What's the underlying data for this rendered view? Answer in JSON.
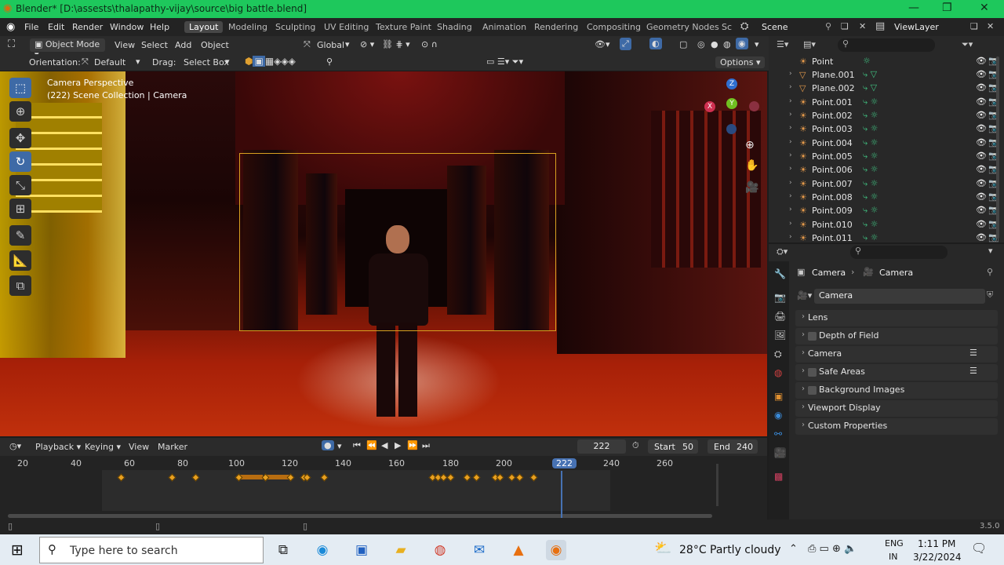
{
  "window": {
    "title": "Blender* [D:\\assests\\thalapathy-vijay\\source\\big battle.blend]"
  },
  "menu": {
    "items": [
      "File",
      "Edit",
      "Render",
      "Window",
      "Help"
    ]
  },
  "workspaces": [
    "Layout",
    "Modeling",
    "Sculpting",
    "UV Editing",
    "Texture Paint",
    "Shading",
    "Animation",
    "Rendering",
    "Compositing",
    "Geometry Nodes",
    "Sc"
  ],
  "scene": {
    "label": "Scene",
    "viewlayer": "ViewLayer"
  },
  "viewport_header": {
    "mode": "Object Mode",
    "menus": [
      "View",
      "Select",
      "Add",
      "Object"
    ],
    "transform": "Global"
  },
  "tool_header": {
    "orientation_label": "Orientation:",
    "orientation_value": "Default",
    "drag_label": "Drag:",
    "drag_value": "Select Box",
    "options": "Options"
  },
  "viewport": {
    "line1": "Camera Perspective",
    "line2": "(222) Scene Collection | Camera",
    "gizmo": {
      "x": "X",
      "y": "Y",
      "z": "Z"
    }
  },
  "timeline": {
    "menus": [
      "Playback",
      "Keying",
      "View",
      "Marker"
    ],
    "current_frame": "222",
    "start_label": "Start",
    "start": "50",
    "end_label": "End",
    "end": "240",
    "ticks": [
      "20",
      "40",
      "60",
      "80",
      "100",
      "120",
      "140",
      "160",
      "180",
      "200",
      "222",
      "240",
      "260"
    ]
  },
  "outliner": {
    "rows": [
      {
        "name": "Point",
        "icon": "light-icon"
      },
      {
        "name": "Plane.001",
        "icon": "mesh-icon"
      },
      {
        "name": "Plane.002",
        "icon": "mesh-icon"
      },
      {
        "name": "Point.001",
        "icon": "light-icon"
      },
      {
        "name": "Point.002",
        "icon": "light-icon"
      },
      {
        "name": "Point.003",
        "icon": "light-icon"
      },
      {
        "name": "Point.004",
        "icon": "light-icon"
      },
      {
        "name": "Point.005",
        "icon": "light-icon"
      },
      {
        "name": "Point.006",
        "icon": "light-icon"
      },
      {
        "name": "Point.007",
        "icon": "light-icon"
      },
      {
        "name": "Point.008",
        "icon": "light-icon"
      },
      {
        "name": "Point.009",
        "icon": "light-icon"
      },
      {
        "name": "Point.010",
        "icon": "light-icon"
      },
      {
        "name": "Point.011",
        "icon": "light-icon"
      }
    ]
  },
  "properties": {
    "breadcrumb_object": "Camera",
    "breadcrumb_data": "Camera",
    "datablock": "Camera",
    "sections": [
      "Lens",
      "Depth of Field",
      "Camera",
      "Safe Areas",
      "Background Images",
      "Viewport Display",
      "Custom Properties"
    ]
  },
  "statusbar": {
    "version": "3.5.0"
  },
  "taskbar": {
    "search_placeholder": "Type here to search",
    "weather": "28°C  Partly cloudy",
    "lang1": "ENG",
    "lang2": "IN",
    "time": "1:11 PM",
    "date": "3/22/2024"
  },
  "colors": {
    "titlebar": "#1ec85c",
    "active_tool": "#3e6aa6",
    "keyframe": "#e8a020",
    "playhead": "#4772b3"
  }
}
